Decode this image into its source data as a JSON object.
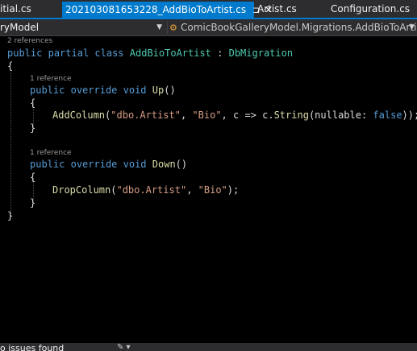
{
  "tabs": [
    {
      "label": "itial.cs",
      "active": false
    },
    {
      "label": "202103081653228_AddBioToArtist.cs",
      "active": true,
      "pin_icon": "pin-icon",
      "close_icon": "close-icon"
    },
    {
      "label": "Artist.cs",
      "active": false
    },
    {
      "label": "Configuration.cs",
      "active": false
    }
  ],
  "nav": {
    "project": "ryModel",
    "member": "ComicBookGalleryModel.Migrations.AddBioToArtist",
    "member_icon": "class-icon"
  },
  "code": {
    "lens_class": "2 references",
    "lens_up": "1 reference",
    "lens_down": "1 reference",
    "class_line": {
      "kw1": "public",
      "kw2": "partial",
      "kw3": "class",
      "name": "AddBioToArtist",
      "colon": " : ",
      "base": "DbMigration"
    },
    "up_sig": {
      "kw1": "public",
      "kw2": "override",
      "kw3": "void",
      "name": "Up",
      "parens": "()"
    },
    "up_body": {
      "method": "AddColumn",
      "open": "(",
      "arg1": "\"dbo.Artist\"",
      "comma1": ", ",
      "arg2": "\"Bio\"",
      "comma2": ", ",
      "lambda": "c => c.",
      "type": "String",
      "open2": "(",
      "param": "nullable",
      "colon": ": ",
      "value": "false",
      "close": "));"
    },
    "down_sig": {
      "kw1": "public",
      "kw2": "override",
      "kw3": "void",
      "name": "Down",
      "parens": "()"
    },
    "down_body": {
      "method": "DropColumn",
      "open": "(",
      "arg1": "\"dbo.Artist\"",
      "comma1": ", ",
      "arg2": "\"Bio\"",
      "close": ");"
    },
    "open_brace": "{",
    "close_brace": "}"
  },
  "status": {
    "text": "o issues found"
  },
  "colors": {
    "active_tab": "#007acc",
    "background": "#000000",
    "keyword": "#569cd6",
    "type": "#4ec9b0",
    "string": "#d69d85"
  }
}
